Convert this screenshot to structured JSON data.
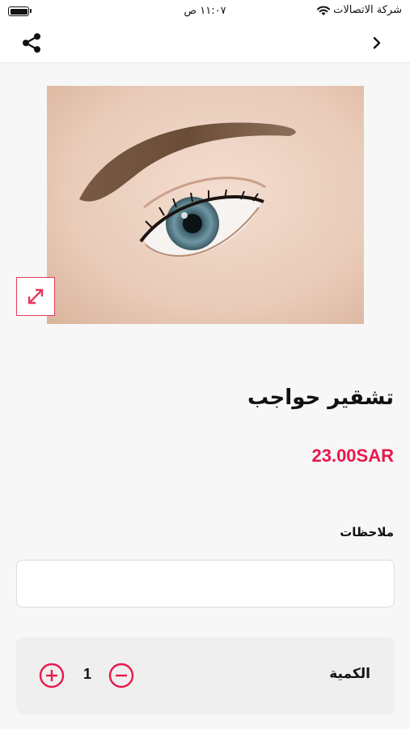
{
  "status_bar": {
    "time": "١١:٠٧ ص",
    "carrier": "شركة الاتصالات",
    "icons": [
      "battery-icon",
      "wifi-icon"
    ]
  },
  "nav": {
    "icons": [
      "share-icon",
      "chevron-right-icon"
    ]
  },
  "product": {
    "title": "تشقير حواجب",
    "price": "23.00SAR",
    "image": "eye-eyebrow-photo"
  },
  "notes": {
    "label": "ملاحظات",
    "value": ""
  },
  "quantity": {
    "label": "الكمية",
    "value": "1",
    "icons": [
      "plus-circle-icon",
      "minus-circle-icon"
    ]
  },
  "colors": {
    "accent": "#e8194c",
    "background": "#f7f7f7"
  }
}
